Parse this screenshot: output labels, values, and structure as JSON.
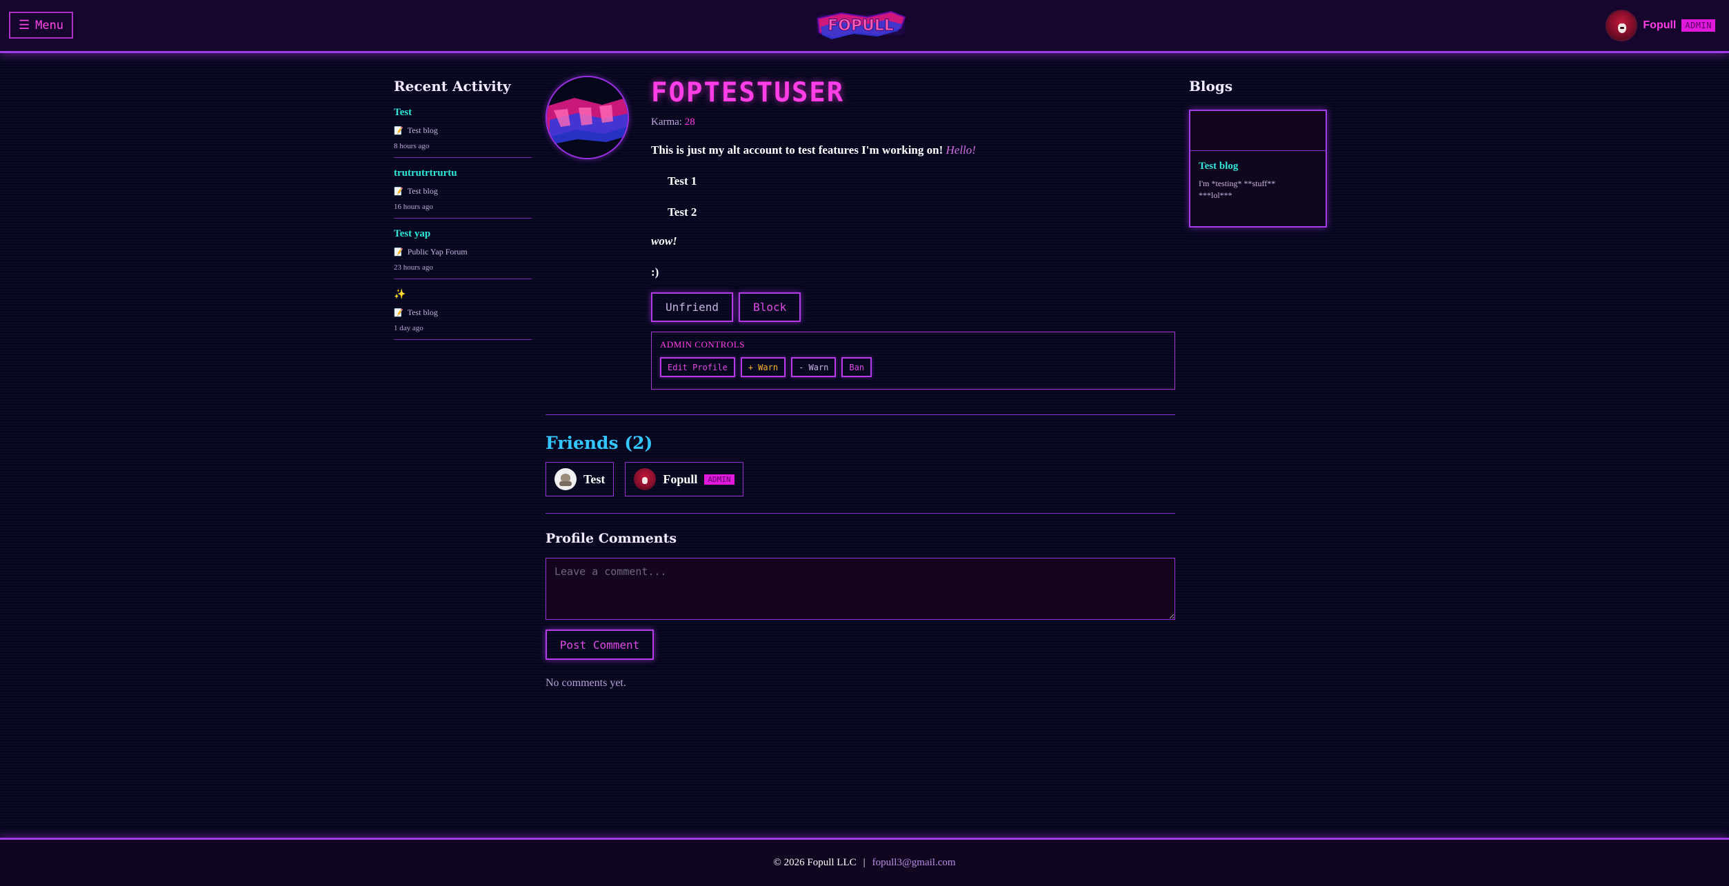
{
  "header": {
    "menu_label": "Menu",
    "logo_text": "FOPULL",
    "user_name": "Fopull",
    "user_badge": "ADMIN"
  },
  "activity": {
    "title": "Recent Activity",
    "items": [
      {
        "title": "Test",
        "source": "Test blog",
        "time": "8 hours ago"
      },
      {
        "title": "trutrutrtrurtu",
        "source": "Test blog",
        "time": "16 hours ago"
      },
      {
        "title": "Test yap",
        "source": "Public Yap Forum",
        "time": "23 hours ago"
      },
      {
        "title": "",
        "source": "Test blog",
        "time": "1 day ago"
      }
    ]
  },
  "profile": {
    "username": "FOPTESTUSER",
    "karma_label": "Karma:",
    "karma_value": "28",
    "bio_text": "This is just my alt account to test features I'm working on!",
    "bio_em": "Hello!",
    "bio_items": [
      "Test 1",
      "Test 2"
    ],
    "bio_wow": "wow!",
    "bio_smile": ":)",
    "unfriend_label": "Unfriend",
    "block_label": "Block"
  },
  "admin": {
    "title": "ADMIN CONTROLS",
    "edit_label": "Edit Profile",
    "warn_plus_label": "+ Warn",
    "warn_minus_label": "- Warn",
    "ban_label": "Ban"
  },
  "friends": {
    "title": "Friends (2)",
    "list": [
      {
        "name": "Test",
        "badge": ""
      },
      {
        "name": "Fopull",
        "badge": "ADMIN"
      }
    ]
  },
  "comments": {
    "title": "Profile Comments",
    "placeholder": "Leave a comment...",
    "post_label": "Post Comment",
    "empty_text": "No comments yet."
  },
  "blogs": {
    "title": "Blogs",
    "cards": [
      {
        "title": "Test blog",
        "excerpt": "I'm *testing* **stuff**\n***lol***"
      }
    ]
  },
  "footer": {
    "copyright": "© 2026 Fopull LLC",
    "separator": "|",
    "email": "fopull3@gmail.com"
  },
  "colors": {
    "accent": "#ff3ee8",
    "border": "#a23dea",
    "link": "#2ee8d8",
    "friends_title": "#34c6ff",
    "background": "#07071f"
  }
}
